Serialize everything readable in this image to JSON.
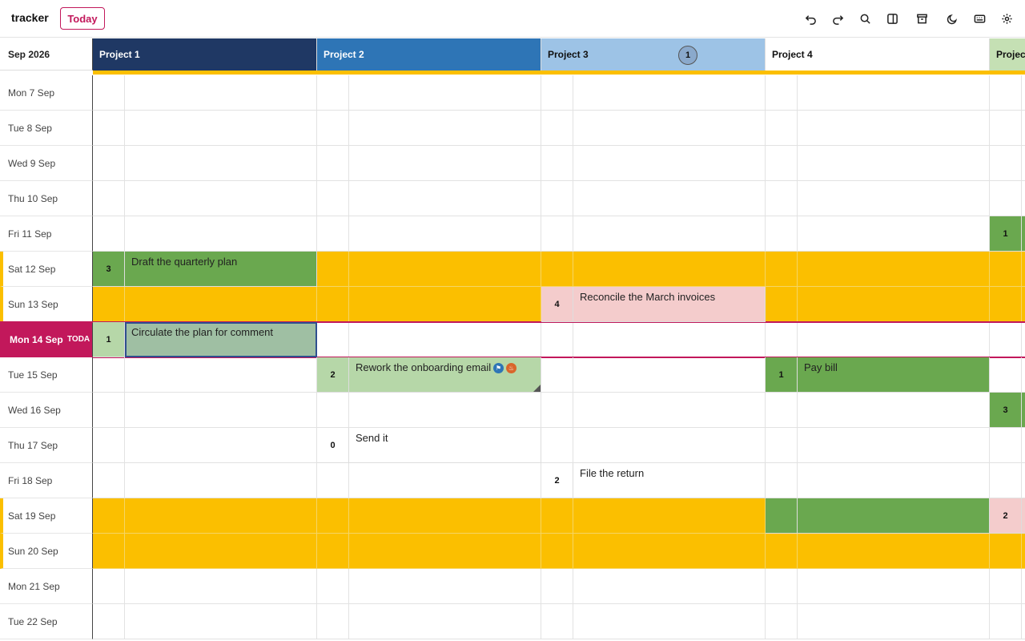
{
  "app": {
    "title": "tracker",
    "today_label": "Today"
  },
  "toolbar": {
    "icons": [
      "undo-icon",
      "redo-icon",
      "search-icon",
      "sidebar-toggle-icon",
      "archive-icon",
      "dark-mode-icon",
      "keyboard-icon",
      "settings-icon"
    ]
  },
  "grid": {
    "month": "Sep 2026",
    "projects": [
      {
        "name": "Project 1",
        "color": "#1f3864",
        "text_color": "#ffffff"
      },
      {
        "name": "Project 2",
        "color": "#2e75b6",
        "text_color": "#ffffff"
      },
      {
        "name": "Project 3",
        "color": "#9dc3e6",
        "text_color": "#111111",
        "badge": "1"
      },
      {
        "name": "Project 4",
        "color": "#ffffff",
        "text_color": "#111111"
      },
      {
        "name": "Projec",
        "color": "#c5e0b4",
        "text_color": "#111111"
      }
    ],
    "days": [
      {
        "label": "Mon 7 Sep",
        "weekend": false
      },
      {
        "label": "Tue 8 Sep",
        "weekend": false
      },
      {
        "label": "Wed 9 Sep",
        "weekend": false
      },
      {
        "label": "Thu 10 Sep",
        "weekend": false
      },
      {
        "label": "Fri 11 Sep",
        "weekend": false
      },
      {
        "label": "Sat 12 Sep",
        "weekend": true
      },
      {
        "label": "Sun 13 Sep",
        "weekend": true
      },
      {
        "label": "Mon 14 Sep",
        "weekend": false,
        "today": true,
        "tag": "TODA"
      },
      {
        "label": "Tue 15 Sep",
        "weekend": false
      },
      {
        "label": "Wed 16 Sep",
        "weekend": false
      },
      {
        "label": "Thu 17 Sep",
        "weekend": false
      },
      {
        "label": "Fri 18 Sep",
        "weekend": false
      },
      {
        "label": "Sat 19 Sep",
        "weekend": true
      },
      {
        "label": "Sun 20 Sep",
        "weekend": true
      },
      {
        "label": "Mon 21 Sep",
        "weekend": false
      },
      {
        "label": "Tue 22 Sep",
        "weekend": false
      }
    ],
    "tasks": [
      {
        "project": 0,
        "day": 5,
        "num": "3",
        "text": "Draft the quarterly plan",
        "bg": "#6aa84f",
        "num_bg": "#6aa84f"
      },
      {
        "project": 2,
        "day": 6,
        "num": "4",
        "text": "Reconcile the March invoices",
        "bg": "#f4cccc",
        "num_bg": "#f4cccc"
      },
      {
        "project": 0,
        "day": 7,
        "num": "1",
        "text": "Circulate the plan for comment",
        "bg": "#9fbfa3",
        "num_bg": "#b6d7a8",
        "selected": true
      },
      {
        "project": 1,
        "day": 8,
        "num": "2",
        "text": "Rework the onboarding email",
        "bg": "#b6d7a8",
        "num_bg": "#b6d7a8",
        "icons": [
          "flag-icon",
          "fire-icon"
        ],
        "corner": true
      },
      {
        "project": 3,
        "day": 8,
        "num": "1",
        "text": "Pay bill",
        "bg": "#6aa84f",
        "num_bg": "#6aa84f"
      },
      {
        "project": 1,
        "day": 10,
        "num": "0",
        "text": "Send it",
        "bg": "#ffffff",
        "num_bg": "#ffffff"
      },
      {
        "project": 2,
        "day": 11,
        "num": "2",
        "text": "File the return",
        "bg": "#ffffff",
        "num_bg": "#ffffff"
      },
      {
        "project": 3,
        "day": 12,
        "num": "",
        "text": "",
        "bg": "#6aa84f",
        "num_bg": "#6aa84f"
      },
      {
        "project": 4,
        "day": 4,
        "num": "1",
        "text": "",
        "bg": "#6aa84f",
        "num_bg": "#6aa84f"
      },
      {
        "project": 4,
        "day": 9,
        "num": "3",
        "text": "",
        "bg": "#6aa84f",
        "num_bg": "#6aa84f"
      },
      {
        "project": 4,
        "day": 12,
        "num": "2",
        "text": "",
        "bg": "#f4cccc",
        "num_bg": "#f4cccc"
      }
    ]
  }
}
